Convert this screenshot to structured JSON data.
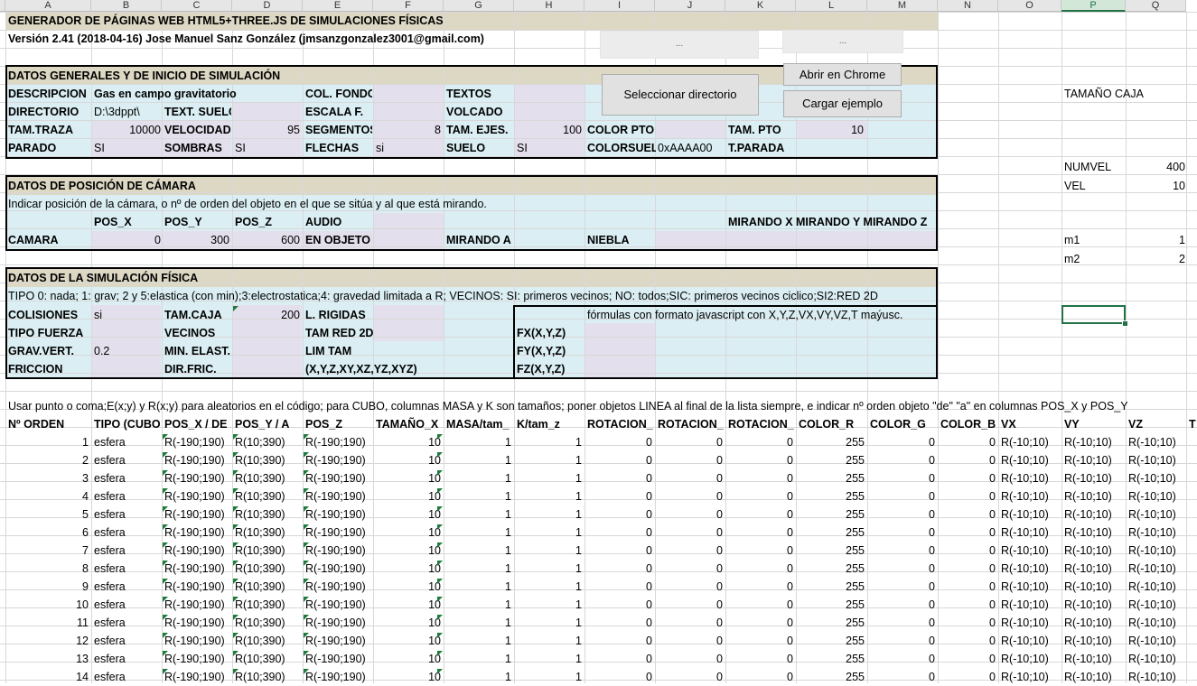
{
  "columns": [
    "A",
    "B",
    "C",
    "D",
    "E",
    "F",
    "G",
    "H",
    "I",
    "J",
    "K",
    "L",
    "M",
    "N",
    "O",
    "P",
    "Q"
  ],
  "selected_column": "P",
  "title": "GENERADOR DE PÁGINAS WEB HTML5+THREE.JS DE SIMULACIONES FÍSICAS",
  "version": "Versión 2.41 (2018-04-16) Jose Manuel Sanz González (jmsanzgonzalez3001@gmail.com)",
  "buttons": {
    "dots1": "...",
    "dots2": "...",
    "select_dir": "Seleccionar directorio",
    "open_chrome": "Abrir en Chrome",
    "load_example": "Cargar ejemplo"
  },
  "general": {
    "heading": "DATOS GENERALES Y DE INICIO DE SIMULACIÓN",
    "descripcion_label": "DESCRIPCION",
    "descripcion_value": "Gas en campo gravitatorio",
    "col_fondo_label": "COL. FONDO",
    "textos_label": "TEXTOS",
    "directorio_label": "DIRECTORIO",
    "directorio_value": "D:\\3dppt\\",
    "text_suelo_label": "TEXT. SUELO",
    "escala_label": "ESCALA F.",
    "volcado_label": "VOLCADO",
    "tam_traza_label": "TAM.TRAZA",
    "tam_traza_value": "10000",
    "velocidad_label": "VELOCIDAD",
    "velocidad_value": "95",
    "segmentos_label": "SEGMENTOS",
    "segmentos_value": "8",
    "tam_ejes_label": "TAM. EJES.",
    "tam_ejes_value": "100",
    "color_pto_label": "COLOR PTO",
    "tam_pto_label": "TAM. PTO",
    "tam_pto_value": "10",
    "parado_label": "PARADO",
    "parado_value": "SI",
    "sombras_label": "SOMBRAS",
    "sombras_value": "SI",
    "flechas_label": "FLECHAS",
    "flechas_value": "si",
    "suelo_label": "SUELO",
    "suelo_value": "SI",
    "colorsuelo_label": "COLORSUELO",
    "colorsuelo_value": "0xAAAA00",
    "tparada_label": "T.PARADA"
  },
  "side": {
    "tamano_caja": "TAMAÑO CAJA",
    "numvel_label": "NUMVEL",
    "numvel_value": "400",
    "vel_label": "VEL",
    "vel_value": "10",
    "m1_label": "m1",
    "m1_value": "1",
    "m2_label": "m2",
    "m2_value": "2"
  },
  "camera": {
    "heading": "DATOS DE POSICIÓN DE CÁMARA",
    "note": "Indicar posición de la cámara, o nº de orden del objeto en el que se sitúa y al que está mirando.",
    "pos_x_label": "POS_X",
    "pos_y_label": "POS_Y",
    "pos_z_label": "POS_Z",
    "audio_label": "AUDIO",
    "mirando_label": "MIRANDO X MIRANDO Y MIRANDO Z",
    "camara_label": "CAMARA",
    "pos_x": "0",
    "pos_y": "300",
    "pos_z": "600",
    "en_objeto_label": "EN OBJETO",
    "mirando_a_label": "MIRANDO A",
    "niebla_label": "NIEBLA"
  },
  "physics": {
    "heading": "DATOS DE LA SIMULACIÓN FÍSICA",
    "tipo_note": "TIPO 0: nada; 1: grav; 2 y 5:elastica (con min);3:electrostatica;4: gravedad limitada a R; VECINOS: SI: primeros vecinos; NO: todos;SIC: primeros vecinos ciclico;SI2:RED 2D",
    "colisiones_label": "COLISIONES",
    "colisiones_value": "si",
    "tam_caja_label": "TAM.CAJA",
    "tam_caja_value": "200",
    "l_rigidas_label": "L. RIGIDAS",
    "formulas_note": "fórmulas con formato javascript con X,Y,Z,VX,VY,VZ,T maýusc.",
    "tipo_fuerza_label": "TIPO FUERZA",
    "vecinos_label": "VECINOS",
    "tam_red_label": "TAM RED 2D",
    "fx_label": "FX(X,Y,Z)",
    "grav_vert_label": "GRAV.VERT.",
    "grav_vert_value": "0.2",
    "min_elast_label": "MIN. ELAST.",
    "lim_tam_label": "LIM TAM",
    "fy_label": "FY(X,Y,Z)",
    "friccion_label": "FRICCION",
    "dir_fric_label": "DIR.FRIC.",
    "xyz_label": "(X,Y,Z,XY,XZ,YZ,XYZ)",
    "fz_label": "FZ(X,Y,Z)"
  },
  "objects": {
    "note": "Usar punto o coma;E(x;y) y R(x;y) para aleatorios en el código; para CUBO, columnas MASA y K son tamaños; poner objetos LINEA al final de la lista siempre, e indicar nº orden objeto \"de\" \"a\" en columnas POS_X y POS_Y",
    "headers": [
      "Nº ORDEN",
      "TIPO (CUBO,",
      "POS_X / DE",
      "POS_Y / A",
      "POS_Z",
      "TAMAÑO_X",
      "MASA/tam_",
      "K/tam_z",
      "ROTACION_",
      "ROTACION_",
      "ROTACION_",
      "COLOR_R",
      "COLOR_G",
      "COLOR_B",
      "VX",
      "VY",
      "VZ",
      "TI"
    ],
    "rows": [
      [
        "1",
        "esfera",
        "R(-190;190)",
        "R(10;390)",
        "R(-190;190)",
        "10",
        "1",
        "1",
        "0",
        "0",
        "0",
        "255",
        "0",
        "0",
        "R(-10;10)",
        "R(-10;10)",
        "R(-10;10)"
      ],
      [
        "2",
        "esfera",
        "R(-190;190)",
        "R(10;390)",
        "R(-190;190)",
        "10",
        "1",
        "1",
        "0",
        "0",
        "0",
        "255",
        "0",
        "0",
        "R(-10;10)",
        "R(-10;10)",
        "R(-10;10)"
      ],
      [
        "3",
        "esfera",
        "R(-190;190)",
        "R(10;390)",
        "R(-190;190)",
        "10",
        "1",
        "1",
        "0",
        "0",
        "0",
        "255",
        "0",
        "0",
        "R(-10;10)",
        "R(-10;10)",
        "R(-10;10)"
      ],
      [
        "4",
        "esfera",
        "R(-190;190)",
        "R(10;390)",
        "R(-190;190)",
        "10",
        "1",
        "1",
        "0",
        "0",
        "0",
        "255",
        "0",
        "0",
        "R(-10;10)",
        "R(-10;10)",
        "R(-10;10)"
      ],
      [
        "5",
        "esfera",
        "R(-190;190)",
        "R(10;390)",
        "R(-190;190)",
        "10",
        "1",
        "1",
        "0",
        "0",
        "0",
        "255",
        "0",
        "0",
        "R(-10;10)",
        "R(-10;10)",
        "R(-10;10)"
      ],
      [
        "6",
        "esfera",
        "R(-190;190)",
        "R(10;390)",
        "R(-190;190)",
        "10",
        "1",
        "1",
        "0",
        "0",
        "0",
        "255",
        "0",
        "0",
        "R(-10;10)",
        "R(-10;10)",
        "R(-10;10)"
      ],
      [
        "7",
        "esfera",
        "R(-190;190)",
        "R(10;390)",
        "R(-190;190)",
        "10",
        "1",
        "1",
        "0",
        "0",
        "0",
        "255",
        "0",
        "0",
        "R(-10;10)",
        "R(-10;10)",
        "R(-10;10)"
      ],
      [
        "8",
        "esfera",
        "R(-190;190)",
        "R(10;390)",
        "R(-190;190)",
        "10",
        "1",
        "1",
        "0",
        "0",
        "0",
        "255",
        "0",
        "0",
        "R(-10;10)",
        "R(-10;10)",
        "R(-10;10)"
      ],
      [
        "9",
        "esfera",
        "R(-190;190)",
        "R(10;390)",
        "R(-190;190)",
        "10",
        "1",
        "1",
        "0",
        "0",
        "0",
        "255",
        "0",
        "0",
        "R(-10;10)",
        "R(-10;10)",
        "R(-10;10)"
      ],
      [
        "10",
        "esfera",
        "R(-190;190)",
        "R(10;390)",
        "R(-190;190)",
        "10",
        "1",
        "1",
        "0",
        "0",
        "0",
        "255",
        "0",
        "0",
        "R(-10;10)",
        "R(-10;10)",
        "R(-10;10)"
      ],
      [
        "11",
        "esfera",
        "R(-190;190)",
        "R(10;390)",
        "R(-190;190)",
        "10",
        "1",
        "1",
        "0",
        "0",
        "0",
        "255",
        "0",
        "0",
        "R(-10;10)",
        "R(-10;10)",
        "R(-10;10)"
      ],
      [
        "12",
        "esfera",
        "R(-190;190)",
        "R(10;390)",
        "R(-190;190)",
        "10",
        "1",
        "1",
        "0",
        "0",
        "0",
        "255",
        "0",
        "0",
        "R(-10;10)",
        "R(-10;10)",
        "R(-10;10)"
      ],
      [
        "13",
        "esfera",
        "R(-190;190)",
        "R(10;390)",
        "R(-190;190)",
        "10",
        "1",
        "1",
        "0",
        "0",
        "0",
        "255",
        "0",
        "0",
        "R(-10;10)",
        "R(-10;10)",
        "R(-10;10)"
      ],
      [
        "14",
        "esfera",
        "R(-190;190)",
        "R(10;390)",
        "R(-190;190)",
        "10",
        "1",
        "1",
        "0",
        "0",
        "0",
        "255",
        "0",
        "0",
        "R(-10;10)",
        "R(-10;10)",
        "R(-10;10)"
      ]
    ]
  }
}
